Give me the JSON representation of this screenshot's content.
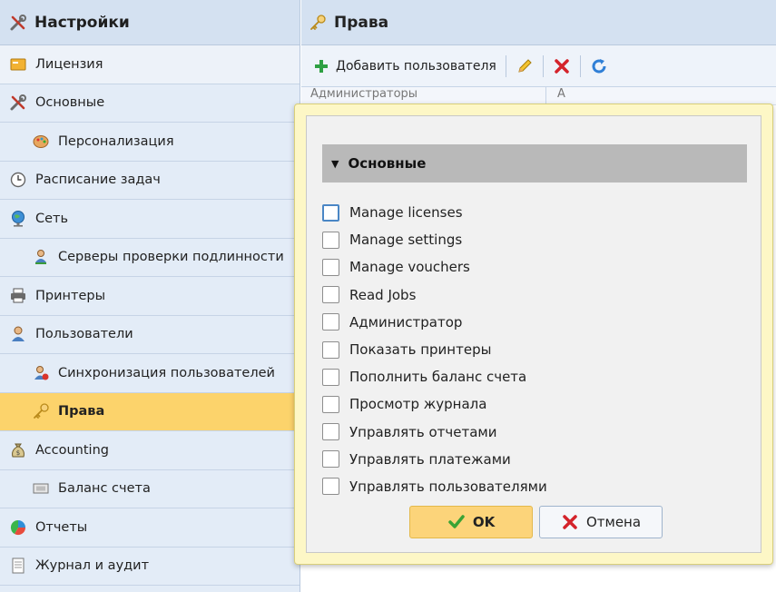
{
  "sidebar": {
    "title": "Настройки",
    "items": [
      {
        "label": "Лицензия",
        "icon": "license-icon",
        "sub": false
      },
      {
        "label": "Основные",
        "icon": "tools-icon",
        "sub": false
      },
      {
        "label": "Персонализация",
        "icon": "palette-icon",
        "sub": true
      },
      {
        "label": "Расписание задач",
        "icon": "clock-icon",
        "sub": false
      },
      {
        "label": "Сеть",
        "icon": "globe-icon",
        "sub": false
      },
      {
        "label": "Серверы проверки подлинности",
        "icon": "user-server-icon",
        "sub": true
      },
      {
        "label": "Принтеры",
        "icon": "printer-icon",
        "sub": false
      },
      {
        "label": "Пользователи",
        "icon": "user-icon",
        "sub": false
      },
      {
        "label": "Синхронизация пользователей",
        "icon": "user-sync-icon",
        "sub": true
      },
      {
        "label": "Права",
        "icon": "key-icon",
        "sub": true,
        "active": true
      },
      {
        "label": "Accounting",
        "icon": "money-bag-icon",
        "sub": false
      },
      {
        "label": "Баланс счета",
        "icon": "bill-icon",
        "sub": true
      },
      {
        "label": "Отчеты",
        "icon": "pie-chart-icon",
        "sub": false
      },
      {
        "label": "Журнал и аудит",
        "icon": "journal-icon",
        "sub": false
      }
    ]
  },
  "main": {
    "title": "Права",
    "toolbar": {
      "add_label": "Добавить пользователя"
    },
    "table": {
      "col1": "Администраторы",
      "col2": "А"
    }
  },
  "dialog": {
    "section_title": "Основные",
    "permissions": [
      {
        "label": "Manage licenses",
        "checked": false
      },
      {
        "label": "Manage settings",
        "checked": false
      },
      {
        "label": "Manage vouchers",
        "checked": false
      },
      {
        "label": "Read Jobs",
        "checked": false
      },
      {
        "label": "Администратор",
        "checked": false
      },
      {
        "label": "Показать принтеры",
        "checked": false
      },
      {
        "label": "Пополнить баланс счета",
        "checked": false
      },
      {
        "label": "Просмотр журнала",
        "checked": false
      },
      {
        "label": "Управлять отчетами",
        "checked": false
      },
      {
        "label": "Управлять платежами",
        "checked": false
      },
      {
        "label": "Управлять пользователями",
        "checked": false
      }
    ],
    "ok_label": "OK",
    "cancel_label": "Отмена"
  },
  "colors": {
    "active_item": "#fcd36b",
    "sidebar_bg": "#e3ecf7",
    "popup_bg": "#fdf7c6"
  }
}
